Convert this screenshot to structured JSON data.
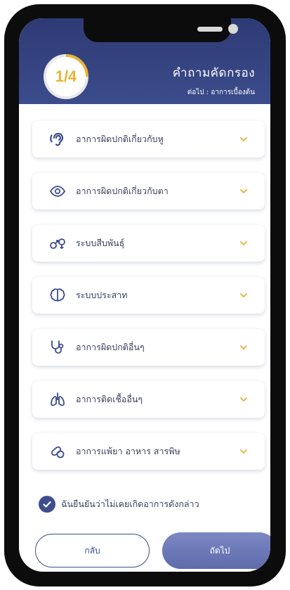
{
  "header": {
    "progress": "1/4",
    "progress_fraction": 0.25,
    "title": "คำถามคัดกรอง",
    "subtitle": "ต่อไป : อาการเบื้องต้น",
    "color": "#34427f",
    "accent": "#e8b431"
  },
  "categories": [
    {
      "label": "อาการผิดปกติเกี่ยวกับหู",
      "icon": "ear-icon"
    },
    {
      "label": "อาการผิดปกติเกี่ยวกับตา",
      "icon": "eye-icon"
    },
    {
      "label": "ระบบสืบพันธุ์",
      "icon": "gender-symbols-icon"
    },
    {
      "label": "ระบบประสาท",
      "icon": "brain-icon"
    },
    {
      "label": "อาการผิดปกติอื่นๆ",
      "icon": "stethoscope-icon"
    },
    {
      "label": "อาการติดเชื้ออื่นๆ",
      "icon": "lungs-icon"
    },
    {
      "label": "อาการแพ้ยา อาหาร สารพิษ",
      "icon": "allergy-icon"
    }
  ],
  "confirm": {
    "label": "ฉันยืนยันว่าไม่เคยเกิดอาการดังกล่าว",
    "checked": true
  },
  "buttons": {
    "back": "กลับ",
    "next": "ถัดไป"
  }
}
